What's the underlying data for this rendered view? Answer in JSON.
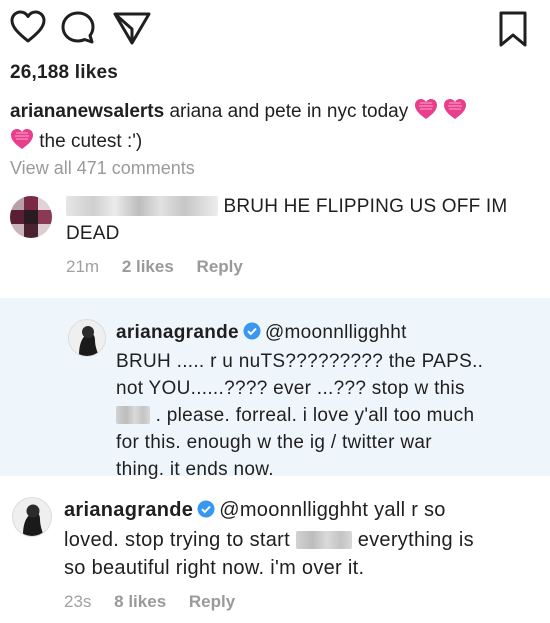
{
  "actions": {
    "like_icon": "heart-outline-icon",
    "comment_icon": "comment-bubble-icon",
    "share_icon": "paper-plane-icon",
    "save_icon": "bookmark-icon"
  },
  "post": {
    "likes": "26,188 likes",
    "caption_user": "ariananеwsalerts",
    "caption_text_1": "ariana and pete in nyc today",
    "caption_text_2": "the cutest :')",
    "view_all": "View all 471 comments"
  },
  "comments": [
    {
      "text_1": "BRUH HE FLIPPING US OFF IM",
      "text_2": "DEAD",
      "time": "21m",
      "likes": "2 likes",
      "reply": "Reply"
    },
    {
      "user": "arianagrande",
      "mention": "@moonnlligghht",
      "line1": "BRUH ..... r u nuTS????????? the PAPS..",
      "line2": "not YOU......???? ever ...??? stop w this",
      "line3": ". please. forreal. i love y'all too much",
      "line4": "for this. enough w the ig / twitter war",
      "line5": "thing. it ends now."
    },
    {
      "user": "arianagrande",
      "mention": "@moonnlligghht",
      "text_1": "yall r so",
      "text_2": "loved. stop trying to start",
      "text_3": "everything is",
      "text_4": "so beautiful right now. i'm over it.",
      "time": "23s",
      "likes": "8 likes",
      "reply": "Reply"
    }
  ],
  "colors": {
    "verified": "#3897f0",
    "heart": "#e83e8c",
    "reply_panel": "#eff6fb",
    "muted": "#a0a0a0"
  }
}
